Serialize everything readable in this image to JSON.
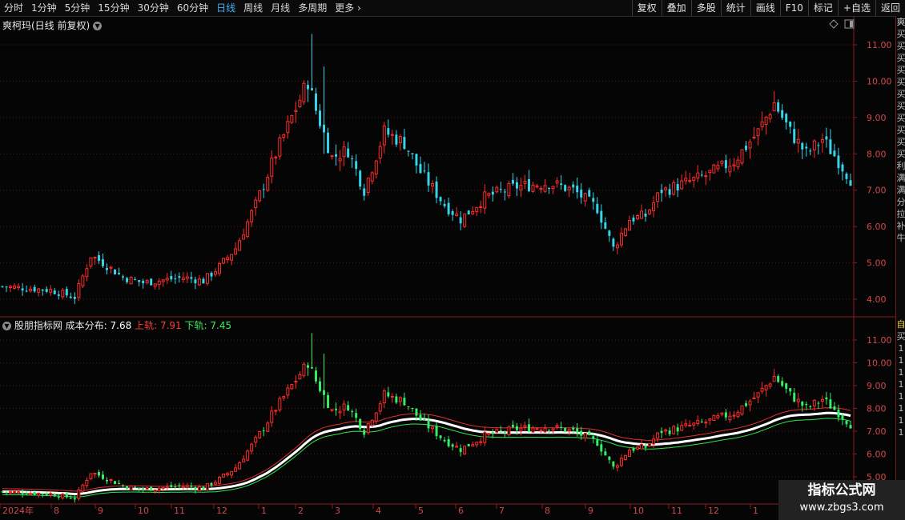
{
  "toolbar": {
    "periods": [
      "分时",
      "1分钟",
      "5分钟",
      "15分钟",
      "30分钟",
      "60分钟",
      "日线",
      "周线",
      "月线",
      "多周期",
      "更多"
    ],
    "active_period": "日线",
    "tools": [
      "复权",
      "叠加",
      "多股",
      "统计",
      "画线",
      "F10",
      "标记",
      "+自选",
      "返回"
    ]
  },
  "main_panel": {
    "title": "爽柯玛(日线 前复权)",
    "y_ticks": [
      "11.00",
      "10.00",
      "9.00",
      "8.00",
      "7.00",
      "6.00",
      "5.00",
      "4.00"
    ]
  },
  "indicator_panel": {
    "name": "股朋指标网",
    "cost_label": "成本分布:",
    "cost_value": "7.68",
    "upper_label": "上轨:",
    "upper_value": "7.91",
    "lower_label": "下轨:",
    "lower_value": "7.45",
    "y_ticks": [
      "11.00",
      "10.00",
      "9.00",
      "8.00",
      "7.00",
      "6.00",
      "5.00"
    ]
  },
  "x_axis": {
    "labels": [
      "2024年",
      "8",
      "9",
      "10",
      "11",
      "12",
      "1",
      "2",
      "3",
      "4",
      "5",
      "6",
      "7",
      "8",
      "9",
      "10",
      "11",
      "12",
      "1"
    ]
  },
  "chart_data": {
    "type": "candlestick",
    "ylim_main": [
      3.8,
      11.6
    ],
    "ylim_indicator": [
      4.9,
      11.6
    ],
    "series_anchors": {
      "x": [
        "2024年",
        "8",
        "9",
        "10",
        "11",
        "12",
        "1",
        "2",
        "3",
        "4",
        "5",
        "6",
        "7",
        "8",
        "9",
        "10",
        "11",
        "12",
        "1"
      ],
      "approx_close": [
        4.2,
        5.1,
        4.5,
        7.0,
        8.2,
        8.0,
        6.4,
        7.0,
        7.0,
        6.0,
        7.3,
        6.6,
        7.0,
        7.7,
        6.7,
        7.2,
        7.4,
        8.6,
        7.7
      ]
    },
    "high_peak": 11.3,
    "lines": {
      "cost_distribution_last": 7.68,
      "upper_band_last": 7.91,
      "lower_band_last": 7.45
    },
    "colors": {
      "up": "#ff2b2b",
      "down": "#35d4e8",
      "indicator_down": "#33ee66",
      "cost_line": "#ffffff",
      "upper_line": "#e03030",
      "lower_line": "#2ee84a",
      "grid": "#5a1414"
    }
  },
  "right_strip_chars": [
    "爽",
    "买",
    "买",
    "买",
    "买",
    "买",
    "买",
    "买",
    "买",
    "买",
    "买",
    "买",
    "利",
    "满",
    "满",
    "分",
    "拉",
    "补",
    "牛"
  ],
  "right_strip_chars2": [
    "自",
    "买",
    "1",
    "1",
    "1",
    "1",
    "1",
    "1",
    "1",
    "1"
  ],
  "watermark": {
    "line1": "指标公式网",
    "line2": "www.zbgs3.com"
  }
}
